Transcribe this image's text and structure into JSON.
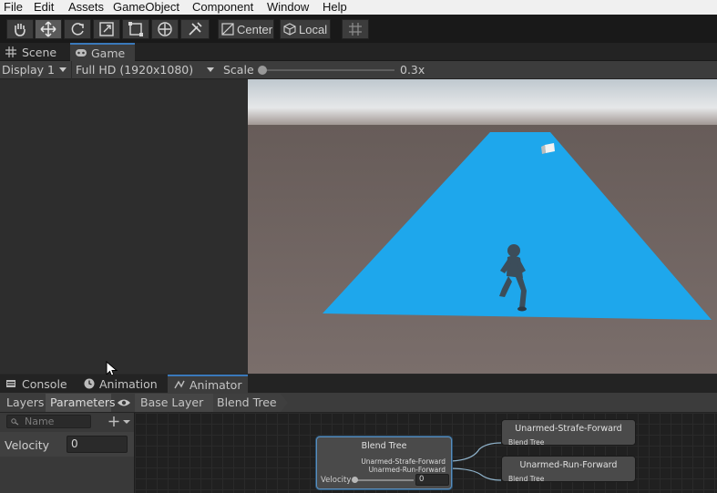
{
  "menu": [
    "File",
    "Edit",
    "Assets",
    "GameObject",
    "Component",
    "Window",
    "Help"
  ],
  "toolbar": {
    "tools": [
      "hand-tool",
      "move-tool",
      "rotate-tool",
      "scale-tool",
      "rect-tool",
      "transform-tool",
      "custom-tool"
    ],
    "pivot_label": "Center",
    "space_label": "Local"
  },
  "view_tabs": {
    "scene": "Scene",
    "game": "Game"
  },
  "game_controls": {
    "display": "Display 1",
    "resolution": "Full HD (1920x1080)",
    "scale_label": "Scale",
    "scale_value": "0.3x",
    "scale_fraction": 0.0
  },
  "bottom_tabs": {
    "console": "Console",
    "animation": "Animation",
    "animator": "Animator"
  },
  "animator": {
    "layers_tab": "Layers",
    "parameters_tab": "Parameters",
    "breadcrumb": [
      "Base Layer",
      "Blend Tree"
    ],
    "search_placeholder": "Name",
    "parameter": {
      "name": "Velocity",
      "value": "0"
    },
    "blend_tree": {
      "title": "Blend Tree",
      "motions": [
        "Unarmed-Strafe-Forward",
        "Unarmed-Run-Forward"
      ],
      "param_name": "Velocity",
      "param_value": "0"
    },
    "motion_nodes": [
      {
        "title": "Unarmed-Strafe-Forward",
        "subtitle": "Blend Tree"
      },
      {
        "title": "Unarmed-Run-Forward",
        "subtitle": "Blend Tree"
      }
    ]
  },
  "colors": {
    "accent": "#3a79bb",
    "floor": "#1ea7ec",
    "ground": "#6e6360",
    "sky": "#ccd5dd"
  }
}
